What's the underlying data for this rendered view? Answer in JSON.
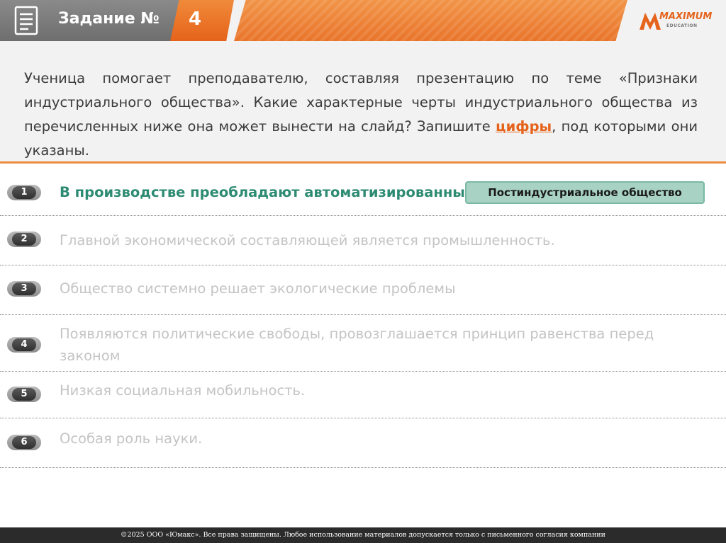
{
  "header": {
    "title": "Задание №",
    "task_number": "4",
    "logo_text": "MAXIMUM",
    "logo_subtext": "EDUCATION"
  },
  "question": {
    "text_part1": "Ученица помогает преподавателю, составляя презентацию по теме «Признаки индустриального общества». Какие характерные черты индустриального общества из перечисленных ниже она может вынести на слайд? Запишите ",
    "keyword": "цифры",
    "text_part2": ", под которыми они указаны."
  },
  "options": [
    {
      "num": "1",
      "text": "В производстве преобладают автоматизированные",
      "state": "active"
    },
    {
      "num": "2",
      "text": "Главной экономической составляющей является промышленность.",
      "state": "faded"
    },
    {
      "num": "3",
      "text": "Общество системно решает экологические проблемы",
      "state": "faded"
    },
    {
      "num": "4",
      "text": "Появляются политические свободы, провозглашается принцип равенства перед законом",
      "state": "faded"
    },
    {
      "num": "5",
      "text": "Низкая социальная мобильность.",
      "state": "faded"
    },
    {
      "num": "6",
      "text": "Особая роль науки.",
      "state": "faded"
    }
  ],
  "badge": {
    "text": "Постиндустриальное общество"
  },
  "footer": {
    "text": "©2025 ООО «Юмакс». Все права защищены. Любое использование материалов допускается только с письменного согласия компании"
  },
  "colors": {
    "accent_orange": "#e5631b",
    "active_green": "#2e8b73",
    "badge_fill": "#a8d3c4"
  }
}
